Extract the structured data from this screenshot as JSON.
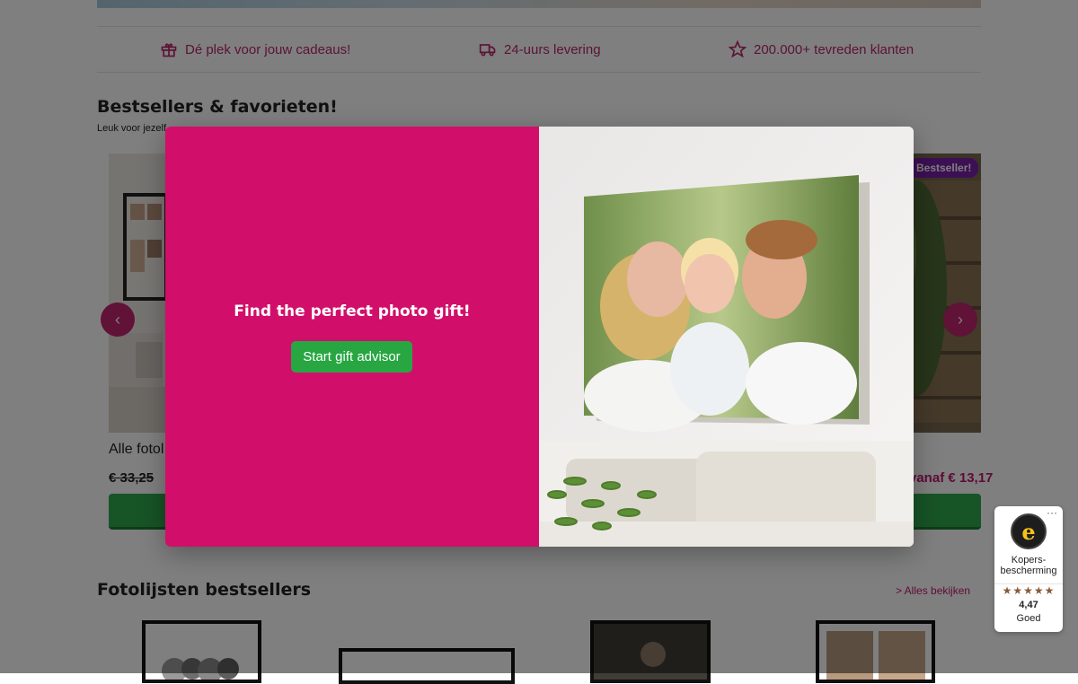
{
  "usp_bar": {
    "items": [
      {
        "icon": "gift-icon",
        "label": "Dé plek voor jouw cadeaus!"
      },
      {
        "icon": "truck-icon",
        "label": "24-uurs levering"
      },
      {
        "icon": "star-icon",
        "label": "200.000+ tevreden klanten"
      }
    ]
  },
  "bestsellers": {
    "title": "Bestsellers & favorieten!",
    "subtitle": "Leuk voor jezelf",
    "cards": [
      {
        "name": "Alle fotol",
        "old_price": "€ 33,25"
      },
      {
        "badge": "Bestseller!",
        "price": "vanaf € 13,17"
      }
    ],
    "prev_arrow": "‹",
    "next_arrow": "›"
  },
  "frames_section": {
    "title": "Fotolijsten bestsellers",
    "see_all": "> Alles bekijken"
  },
  "modal": {
    "title": "Find the perfect photo gift!",
    "button": "Start gift advisor"
  },
  "trust_badge": {
    "menu": "···",
    "label_line1": "Kopers-",
    "label_line2": "bescherming",
    "stars": "★★★★★",
    "score": "4,47",
    "rating_label": "Goed",
    "rating_value": 4.47
  },
  "colors": {
    "brand_magenta": "#d10f6a",
    "usp_text": "#b8276a",
    "cta_green": "#2ea84d",
    "badge_purple": "#7b1fa8"
  }
}
